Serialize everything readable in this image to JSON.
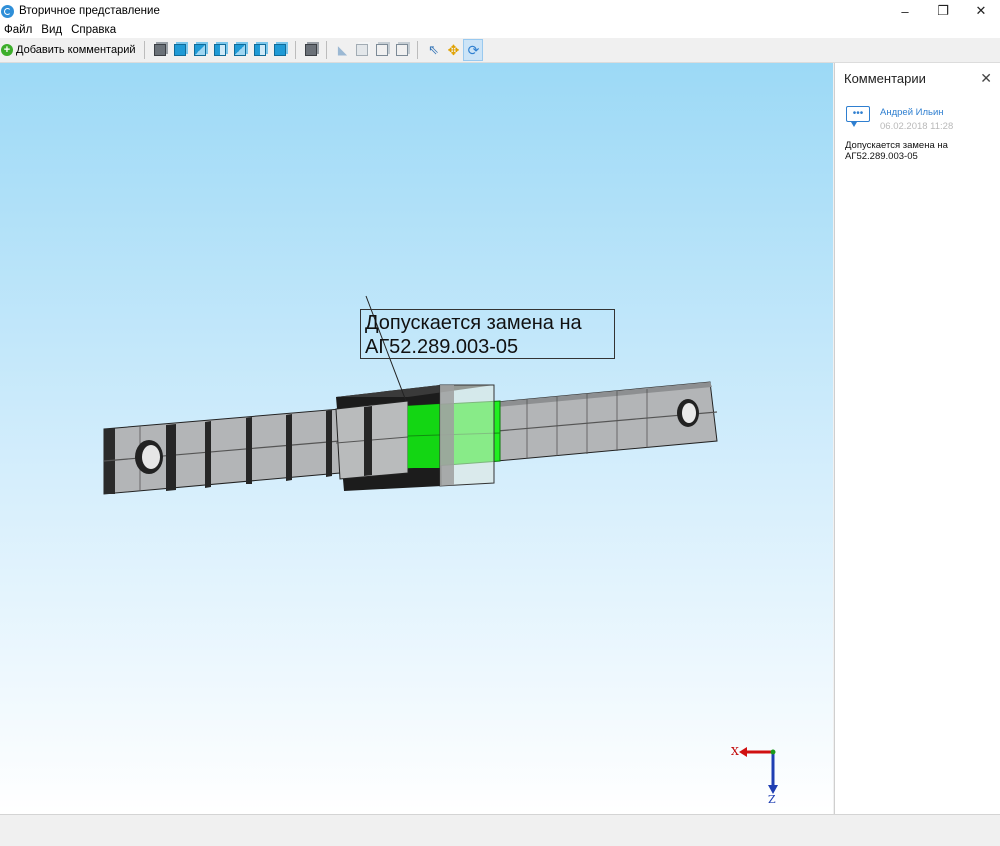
{
  "window": {
    "title": "Вторичное представление",
    "controls": {
      "minimize": "–",
      "restore": "❐",
      "close": "✕"
    }
  },
  "menu": {
    "items": [
      "Файл",
      "Вид",
      "Справка"
    ]
  },
  "toolbar": {
    "add_comment_label": "Добавить комментарий",
    "buttons": [
      "iso-view-icon",
      "front-view-icon",
      "back-view-icon",
      "left-view-icon",
      "right-view-icon",
      "top-view-icon",
      "bottom-view-icon",
      "shaded-mode-icon",
      "hidden-lines-icon",
      "shaded-edges-icon",
      "wireframe-icon",
      "transparent-mode-icon",
      "select-cursor-icon",
      "pan-icon",
      "rotate-icon"
    ],
    "active_tool": "rotate-icon"
  },
  "viewport": {
    "annotation": [
      "Допускается замена на",
      "АГ52.289.003-05"
    ],
    "axis_x": "X",
    "axis_z": "Z",
    "colors": {
      "highlight": "#19e619",
      "part": "#a9abad",
      "background_top": "#9cd9f6"
    }
  },
  "comments_panel": {
    "title": "Комментарии",
    "close": "✕",
    "comments": [
      {
        "author": "Андрей Ильин",
        "date": "06.02.2018 11:28",
        "text": "Допускается замена на АГ52.289.003-05"
      }
    ]
  }
}
